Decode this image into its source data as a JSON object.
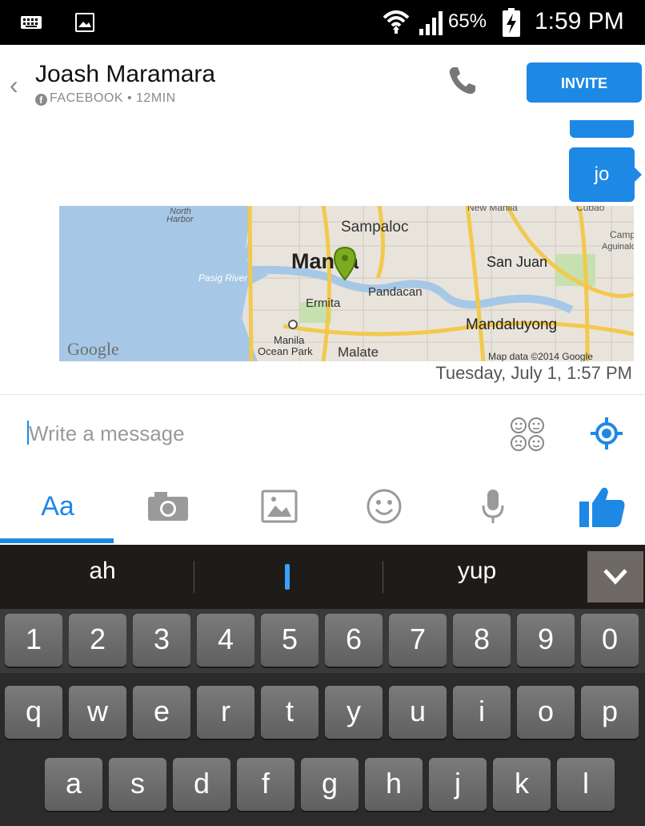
{
  "status_bar": {
    "battery": "65%",
    "time": "1:59 PM",
    "icons": [
      "keyboard-icon",
      "image-icon",
      "wifi-icon",
      "signal-icon",
      "battery-charging-icon"
    ]
  },
  "header": {
    "contact_name": "Joash Maramara",
    "subtitle": "FACEBOOK • 12MIN",
    "invite_label": "INVITE",
    "icons": [
      "back-chevron-icon",
      "facebook-icon",
      "phone-icon"
    ]
  },
  "conversation": {
    "messages": [
      {
        "text": "jo",
        "sender": "me"
      }
    ],
    "map": {
      "labels": [
        "North Harbor",
        "Sampaloc",
        "New Manila",
        "Cubao",
        "Camp Aguinaldo",
        "Manila",
        "San Juan",
        "Pasig River",
        "Pandacan",
        "Ermita",
        "Mandaluyong",
        "Manila Ocean Park",
        "Malate"
      ],
      "provider": "Google",
      "attribution": "Map data ©2014 Google"
    },
    "timestamp": "Tuesday, July 1, 1:57 PM"
  },
  "compose": {
    "placeholder": "Write a message",
    "icons": [
      "stickers-icon",
      "location-icon"
    ]
  },
  "tabs": {
    "text_label": "Aa",
    "icons": [
      "camera-icon",
      "gallery-icon",
      "emoji-icon",
      "microphone-icon",
      "thumbs-up-icon"
    ]
  },
  "keyboard": {
    "suggestions": [
      "ah",
      "I",
      "yup"
    ],
    "number_row": [
      "1",
      "2",
      "3",
      "4",
      "5",
      "6",
      "7",
      "8",
      "9",
      "0"
    ],
    "row1": [
      "q",
      "w",
      "e",
      "r",
      "t",
      "y",
      "u",
      "i",
      "o",
      "p"
    ],
    "row2": [
      "a",
      "s",
      "d",
      "f",
      "g",
      "h",
      "j",
      "k",
      "l"
    ]
  },
  "colors": {
    "accent": "#1e88e5",
    "status_bar": "#000000",
    "keyboard_bg": "#2b2b2b",
    "pin": "#7cab1f"
  }
}
